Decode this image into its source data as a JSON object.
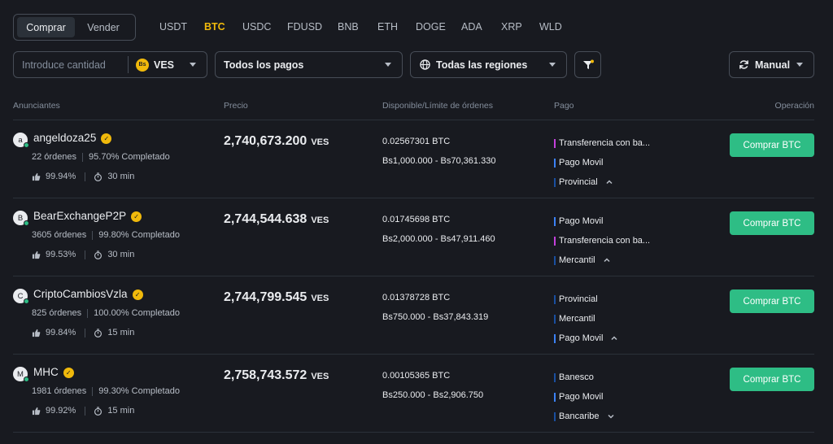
{
  "side_toggle": {
    "buy": "Comprar",
    "sell": "Vender"
  },
  "assets": [
    "USDT",
    "BTC",
    "USDC",
    "FDUSD",
    "BNB",
    "ETH",
    "DOGE",
    "ADA",
    "XRP",
    "WLD"
  ],
  "active_asset": "BTC",
  "filters": {
    "amount_placeholder": "Introduce cantidad",
    "fiat": "VES",
    "fiat_icon_text": "Bs",
    "payments": "Todos los pagos",
    "regions": "Todas las regiones",
    "refresh_mode": "Manual"
  },
  "headers": {
    "advertisers": "Anunciantes",
    "price": "Precio",
    "available": "Disponible/Límite de órdenes",
    "payment": "Pago",
    "operation": "Operación"
  },
  "colors": {
    "background": "#181a20",
    "accent": "#f0b90b",
    "buy_green": "#2ebd85",
    "pay_purple": "#c440dc",
    "pay_blue": "#3b82f6",
    "pay_navy": "#1a4fa0"
  },
  "ads": [
    {
      "avatar": "a",
      "name": "angeldoza25",
      "orders": "22 órdenes",
      "completion": "95.70% Completado",
      "rating": "99.94%",
      "time": "30 min",
      "price": "2,740,673.200",
      "price_unit": "VES",
      "available": "0.02567301 BTC",
      "limit": "Bs1,000.000 - Bs70,361.330",
      "payments": [
        {
          "label": "Transferencia con ba...",
          "color": "#c440dc"
        },
        {
          "label": "Pago Movil",
          "color": "#3b82f6"
        },
        {
          "label": "Provincial",
          "color": "#1a4fa0"
        }
      ],
      "toggle_icon": "chevron-up-icon",
      "button": "Comprar BTC"
    },
    {
      "avatar": "B",
      "name": "BearExchangeP2P",
      "orders": "3605 órdenes",
      "completion": "99.80% Completado",
      "rating": "99.53%",
      "time": "30 min",
      "price": "2,744,544.638",
      "price_unit": "VES",
      "available": "0.01745698 BTC",
      "limit": "Bs2,000.000 - Bs47,911.460",
      "payments": [
        {
          "label": "Pago Movil",
          "color": "#3b82f6"
        },
        {
          "label": "Transferencia con ba...",
          "color": "#c440dc"
        },
        {
          "label": "Mercantil",
          "color": "#1a4fa0"
        }
      ],
      "toggle_icon": "chevron-up-icon",
      "button": "Comprar BTC"
    },
    {
      "avatar": "C",
      "name": "CriptoCambiosVzla",
      "orders": "825 órdenes",
      "completion": "100.00% Completado",
      "rating": "99.84%",
      "time": "15 min",
      "price": "2,744,799.545",
      "price_unit": "VES",
      "available": "0.01378728 BTC",
      "limit": "Bs750.000 - Bs37,843.319",
      "payments": [
        {
          "label": "Provincial",
          "color": "#1a4fa0"
        },
        {
          "label": "Mercantil",
          "color": "#1a4fa0"
        },
        {
          "label": "Pago Movil",
          "color": "#3b82f6"
        }
      ],
      "toggle_icon": "chevron-up-icon",
      "button": "Comprar BTC"
    },
    {
      "avatar": "M",
      "name": "MHC",
      "orders": "1981 órdenes",
      "completion": "99.30% Completado",
      "rating": "99.92%",
      "time": "15 min",
      "price": "2,758,743.572",
      "price_unit": "VES",
      "available": "0.00105365 BTC",
      "limit": "Bs250.000 - Bs2,906.750",
      "payments": [
        {
          "label": "Banesco",
          "color": "#1a4fa0"
        },
        {
          "label": "Pago Movil",
          "color": "#3b82f6"
        },
        {
          "label": "Bancaribe",
          "color": "#1a4fa0"
        }
      ],
      "toggle_icon": "chevron-down-icon",
      "button": "Comprar BTC"
    }
  ]
}
